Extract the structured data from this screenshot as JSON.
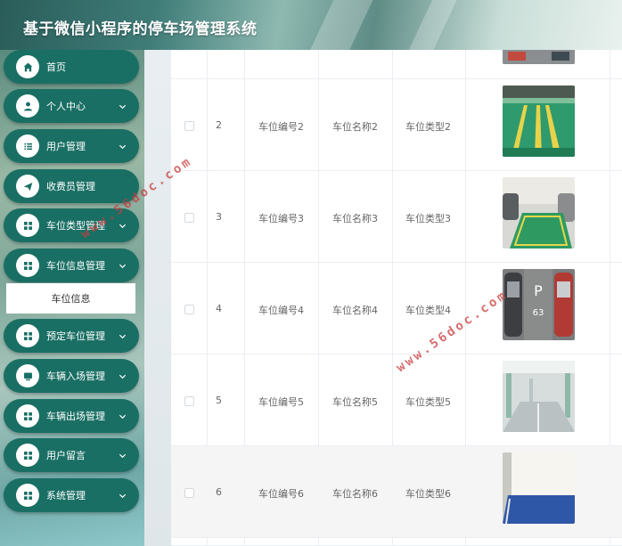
{
  "app": {
    "title": "基于微信小程序的停车场管理系统"
  },
  "sidebar": {
    "items": [
      {
        "label": "首页",
        "icon": "home-icon",
        "has_chevron": false
      },
      {
        "label": "个人中心",
        "icon": "user-icon",
        "has_chevron": true
      },
      {
        "label": "用户管理",
        "icon": "list-icon",
        "has_chevron": true
      },
      {
        "label": "收费员管理",
        "icon": "send-icon",
        "has_chevron": false
      },
      {
        "label": "车位类型管理",
        "icon": "grid-icon",
        "has_chevron": true
      },
      {
        "label": "车位信息管理",
        "icon": "grid-icon",
        "has_chevron": true,
        "expanded": true
      },
      {
        "label": "预定车位管理",
        "icon": "grid-icon",
        "has_chevron": true
      },
      {
        "label": "车辆入场管理",
        "icon": "monitor-icon",
        "has_chevron": true
      },
      {
        "label": "车辆出场管理",
        "icon": "grid-icon",
        "has_chevron": true
      },
      {
        "label": "用户留言",
        "icon": "grid-icon",
        "has_chevron": true
      },
      {
        "label": "系统管理",
        "icon": "grid-icon",
        "has_chevron": true
      }
    ],
    "submenu": {
      "label": "车位信息"
    }
  },
  "table": {
    "rows": [
      {
        "index": "2",
        "code": "车位编号2",
        "name": "车位名称2",
        "type": "车位类型2",
        "image": "parking-photo-green-floor"
      },
      {
        "index": "3",
        "code": "车位编号3",
        "name": "车位名称3",
        "type": "车位类型3",
        "image": "parking-photo-green-bay"
      },
      {
        "index": "4",
        "code": "车位编号4",
        "name": "车位名称4",
        "type": "车位类型4",
        "image": "parking-photo-cars-p63"
      },
      {
        "index": "5",
        "code": "车位编号5",
        "name": "车位名称5",
        "type": "车位类型5",
        "image": "parking-photo-garage-lane"
      },
      {
        "index": "6",
        "code": "车位编号6",
        "name": "车位名称6",
        "type": "车位类型6",
        "image": "parking-photo-blue-bay"
      }
    ]
  },
  "watermark": {
    "text": "www.56doc.com",
    "color": "#c83c3c"
  },
  "colors": {
    "menu_bg": "#1a6f64",
    "header_text": "#ffffff"
  }
}
